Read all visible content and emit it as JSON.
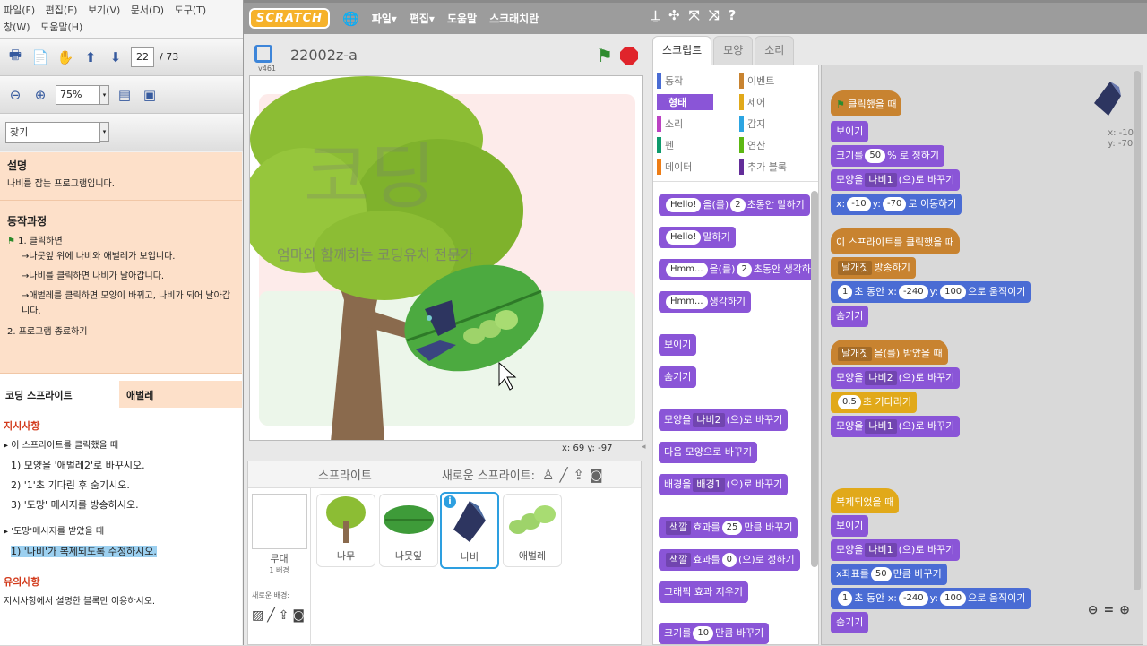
{
  "pdf": {
    "menu_row1": [
      "파일(F)",
      "편집(E)",
      "보기(V)",
      "문서(D)",
      "도구(T)"
    ],
    "menu_row2": [
      "창(W)",
      "도움말(H)"
    ],
    "page_current": "22",
    "page_total": "/ 73",
    "zoom": "75%",
    "find_label": "찾기",
    "desc_title": "설명",
    "desc_text": "나비를 잡는 프로그램입니다.",
    "process_title": "동작과정",
    "process_steps": [
      "1.  클릭하면",
      "→나뭇잎 위에 나비와 애벌레가 보입니다.",
      "→나비를 클릭하면 나비가 날아갑니다.",
      "→애벌레를 클릭하면 모양이 바뀌고, 나비가 되어 날아갑니다.",
      "2. 프로그램 종료하기"
    ],
    "tab_coding": "코딩 스프라이트",
    "tab_target": "애벌레",
    "inst_title": "지시사항",
    "inst_lines": [
      "▸ 이 스프라이트를 클릭했을 때",
      "1) 모양을 '애벌레2'로 바꾸시오.",
      "2) '1'초 기다린 후 숨기시오.",
      "3) '도망' 메시지를 방송하시오.",
      "▸ '도망'메시지를 받았을 때",
      "1) '나비'가 복제되도록 수정하시오."
    ],
    "caution_title": "유의사항",
    "caution_text": "지시사항에서 설명한 블록만 이용하시오."
  },
  "scratch": {
    "logo": "SCRATCH",
    "menus": [
      "파일▾",
      "편집▾",
      "도움말",
      "스크래치란"
    ],
    "project_name": "22002z-a",
    "version": "v461",
    "banner_text": "엄마와 함께하는 코딩유치 전문가",
    "stage_coords": "x: 69   y: -97",
    "sprites_label": "스프라이트",
    "new_sprite_label": "새로운 스프라이트:",
    "stage_thumb_label": "무대",
    "stage_thumb_sub": "1 배경",
    "new_backdrop_label": "새로운 배경:",
    "sprite_thumbs": [
      "나무",
      "나뭇잎",
      "나비",
      "애벌레"
    ],
    "tabs": [
      "스크립트",
      "모양",
      "소리"
    ],
    "categories": [
      {
        "label": "동작",
        "color": "#4a6cd4"
      },
      {
        "label": "이벤트",
        "color": "#c88330"
      },
      {
        "label": "형태",
        "color": "#8a55d7"
      },
      {
        "label": "제어",
        "color": "#e1a91a"
      },
      {
        "label": "소리",
        "color": "#bb42c3"
      },
      {
        "label": "감지",
        "color": "#2ca5e2"
      },
      {
        "label": "펜",
        "color": "#0e9a6c"
      },
      {
        "label": "연산",
        "color": "#5cb712"
      },
      {
        "label": "데이터",
        "color": "#ee7d16"
      },
      {
        "label": "추가 블록",
        "color": "#632d99"
      }
    ],
    "sprite_xy": "x: -10\ny: -70",
    "palette_blocks": {
      "say_secs": {
        "a": "Hello!",
        "b": "을(를)",
        "c": "2",
        "d": "초동안 말하기"
      },
      "say": {
        "a": "Hello!",
        "b": "말하기"
      },
      "think_secs": {
        "a": "Hmm...",
        "b": "을(를)",
        "c": "2",
        "d": "초동안 생각하기"
      },
      "think": {
        "a": "Hmm...",
        "b": "생각하기"
      },
      "show": "보이기",
      "hide": "숨기기",
      "switch_costume": {
        "a": "모양을",
        "b": "나비2",
        "c": "(으)로 바꾸기"
      },
      "next_costume": "다음 모양으로 바꾸기",
      "switch_backdrop": {
        "a": "배경을",
        "b": "배경1",
        "c": "(으)로 바꾸기"
      },
      "change_effect": {
        "a": "색깔",
        "b": "효과를",
        "c": "25",
        "d": "만큼 바꾸기"
      },
      "set_effect": {
        "a": "색깔",
        "b": "효과를",
        "c": "0",
        "d": "(으)로 정하기"
      },
      "clear_effects": "그래픽 효과 지우기",
      "change_size": {
        "a": "크기를",
        "b": "10",
        "c": "만큼 바꾸기"
      }
    },
    "script1": {
      "hat": "클릭했을 때",
      "show": "보이기",
      "size": {
        "a": "크기를",
        "b": "50",
        "c": "% 로 정하기"
      },
      "costume": {
        "a": "모양을",
        "b": "나비1",
        "c": "(으)로 바꾸기"
      },
      "goto": {
        "a": "x:",
        "b": "-10",
        "c": "y:",
        "d": "-70",
        "e": "로 이동하기"
      }
    },
    "script2": {
      "hat": "이 스프라이트를 클릭했을 때",
      "broadcast": {
        "a": "날개짓",
        "b": "방송하기"
      },
      "glide": {
        "a": "1",
        "b": "초 동안 x:",
        "c": "-240",
        "d": "y:",
        "e": "100",
        "f": "으로 움직이기"
      },
      "hide": "숨기기"
    },
    "script3": {
      "hat": {
        "a": "날개짓",
        "b": "을(를) 받았을 때"
      },
      "costume2": {
        "a": "모양을",
        "b": "나비2",
        "c": "(으)로 바꾸기"
      },
      "wait": {
        "a": "0.5",
        "b": "초 기다리기"
      },
      "costume1": {
        "a": "모양을",
        "b": "나비1",
        "c": "(으)로 바꾸기"
      }
    },
    "script4": {
      "hat": "복제되었을 때",
      "show": "보이기",
      "costume": {
        "a": "모양을",
        "b": "나비1",
        "c": "(으)로 바꾸기"
      },
      "xset": {
        "a": "x좌표를",
        "b": "50",
        "c": "만큼 바꾸기"
      },
      "glide": {
        "a": "1",
        "b": "초 동안 x:",
        "c": "-240",
        "d": "y:",
        "e": "100",
        "f": "으로 움직이기"
      },
      "hide": "숨기기"
    }
  }
}
